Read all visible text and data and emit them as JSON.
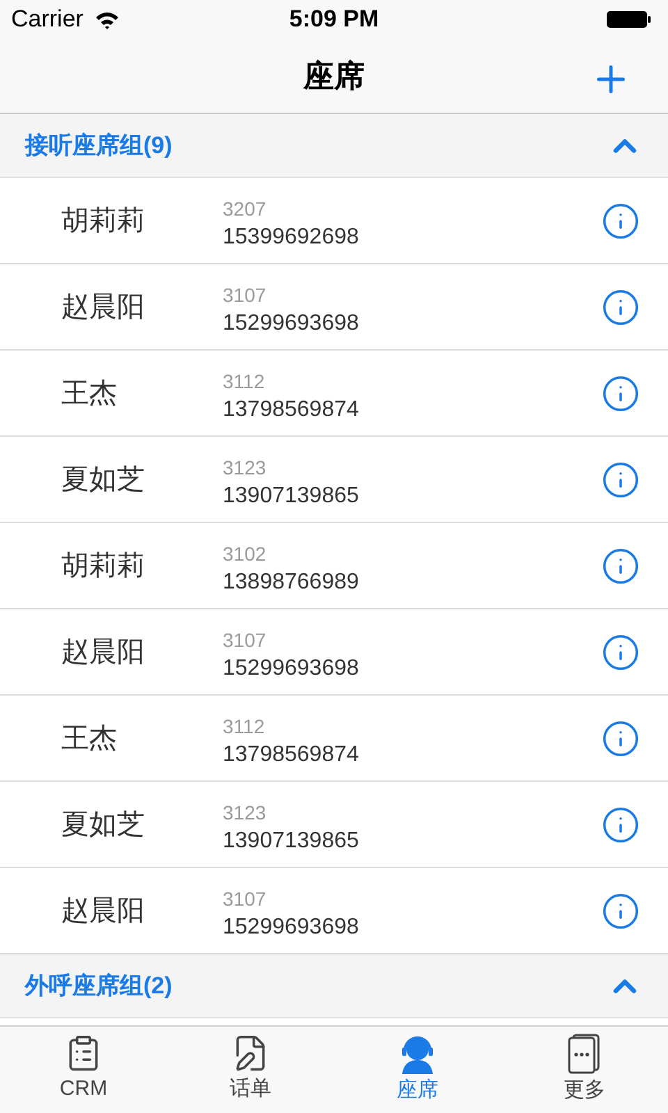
{
  "status_bar": {
    "carrier": "Carrier",
    "time": "5:09 PM"
  },
  "nav": {
    "title": "座席"
  },
  "groups": [
    {
      "title": "接听座席组(9)",
      "expanded": true,
      "members": [
        {
          "name": "胡莉莉",
          "ext": "3207",
          "phone": "15399692698"
        },
        {
          "name": "赵晨阳",
          "ext": "3107",
          "phone": "15299693698"
        },
        {
          "name": "王杰",
          "ext": "3112",
          "phone": "13798569874"
        },
        {
          "name": "夏如芝",
          "ext": "3123",
          "phone": "13907139865"
        },
        {
          "name": "胡莉莉",
          "ext": "3102",
          "phone": "13898766989"
        },
        {
          "name": "赵晨阳",
          "ext": "3107",
          "phone": "15299693698"
        },
        {
          "name": "王杰",
          "ext": "3112",
          "phone": "13798569874"
        },
        {
          "name": "夏如芝",
          "ext": "3123",
          "phone": "13907139865"
        },
        {
          "name": "赵晨阳",
          "ext": "3107",
          "phone": "15299693698"
        }
      ]
    },
    {
      "title": "外呼座席组(2)",
      "expanded": true
    }
  ],
  "tabs": [
    {
      "kind": "crm",
      "label": "CRM",
      "selected": false
    },
    {
      "kind": "bills",
      "label": "话单",
      "selected": false
    },
    {
      "kind": "agents",
      "label": "座席",
      "selected": true
    },
    {
      "kind": "more",
      "label": "更多",
      "selected": false
    }
  ]
}
